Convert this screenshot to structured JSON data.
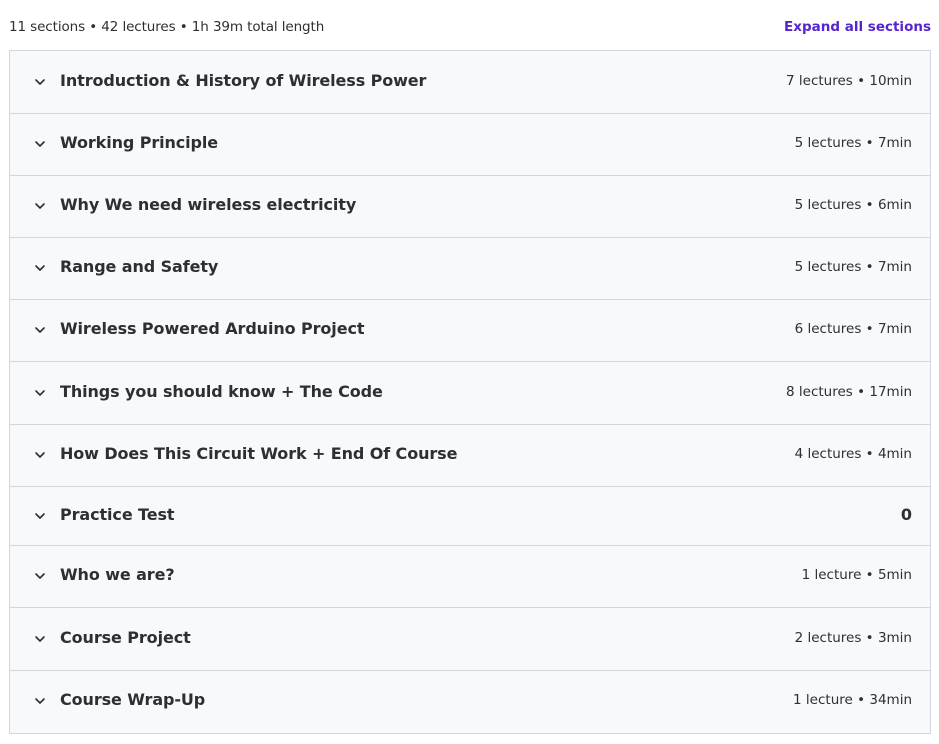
{
  "header": {
    "summary": "11 sections • 42 lectures • 1h 39m total length",
    "expand_label": "Expand all sections"
  },
  "colors": {
    "accent": "#5624d0",
    "row_bg": "#f7f9fa",
    "border": "#d1d7dc",
    "text": "#2d2f31"
  },
  "icons": {
    "section_toggle": "chevron-down-icon"
  },
  "sections": [
    {
      "title": "Introduction & History of Wireless Power",
      "meta": "7 lectures • 10min"
    },
    {
      "title": "Working Principle",
      "meta": "5 lectures • 7min"
    },
    {
      "title": "Why We need wireless electricity",
      "meta": "5 lectures • 6min"
    },
    {
      "title": "Range and Safety",
      "meta": "5 lectures • 7min"
    },
    {
      "title": "Wireless Powered Arduino Project",
      "meta": "6 lectures • 7min"
    },
    {
      "title": "Things you should know + The Code",
      "meta": "8 lectures • 17min"
    },
    {
      "title": "How Does This Circuit Work + End Of Course",
      "meta": "4 lectures • 4min"
    },
    {
      "title": "Practice Test",
      "meta": "0"
    },
    {
      "title": "Who we are?",
      "meta": "1 lecture • 5min"
    },
    {
      "title": "Course Project",
      "meta": "2 lectures • 3min"
    },
    {
      "title": "Course Wrap-Up",
      "meta": "1 lecture • 34min"
    }
  ]
}
